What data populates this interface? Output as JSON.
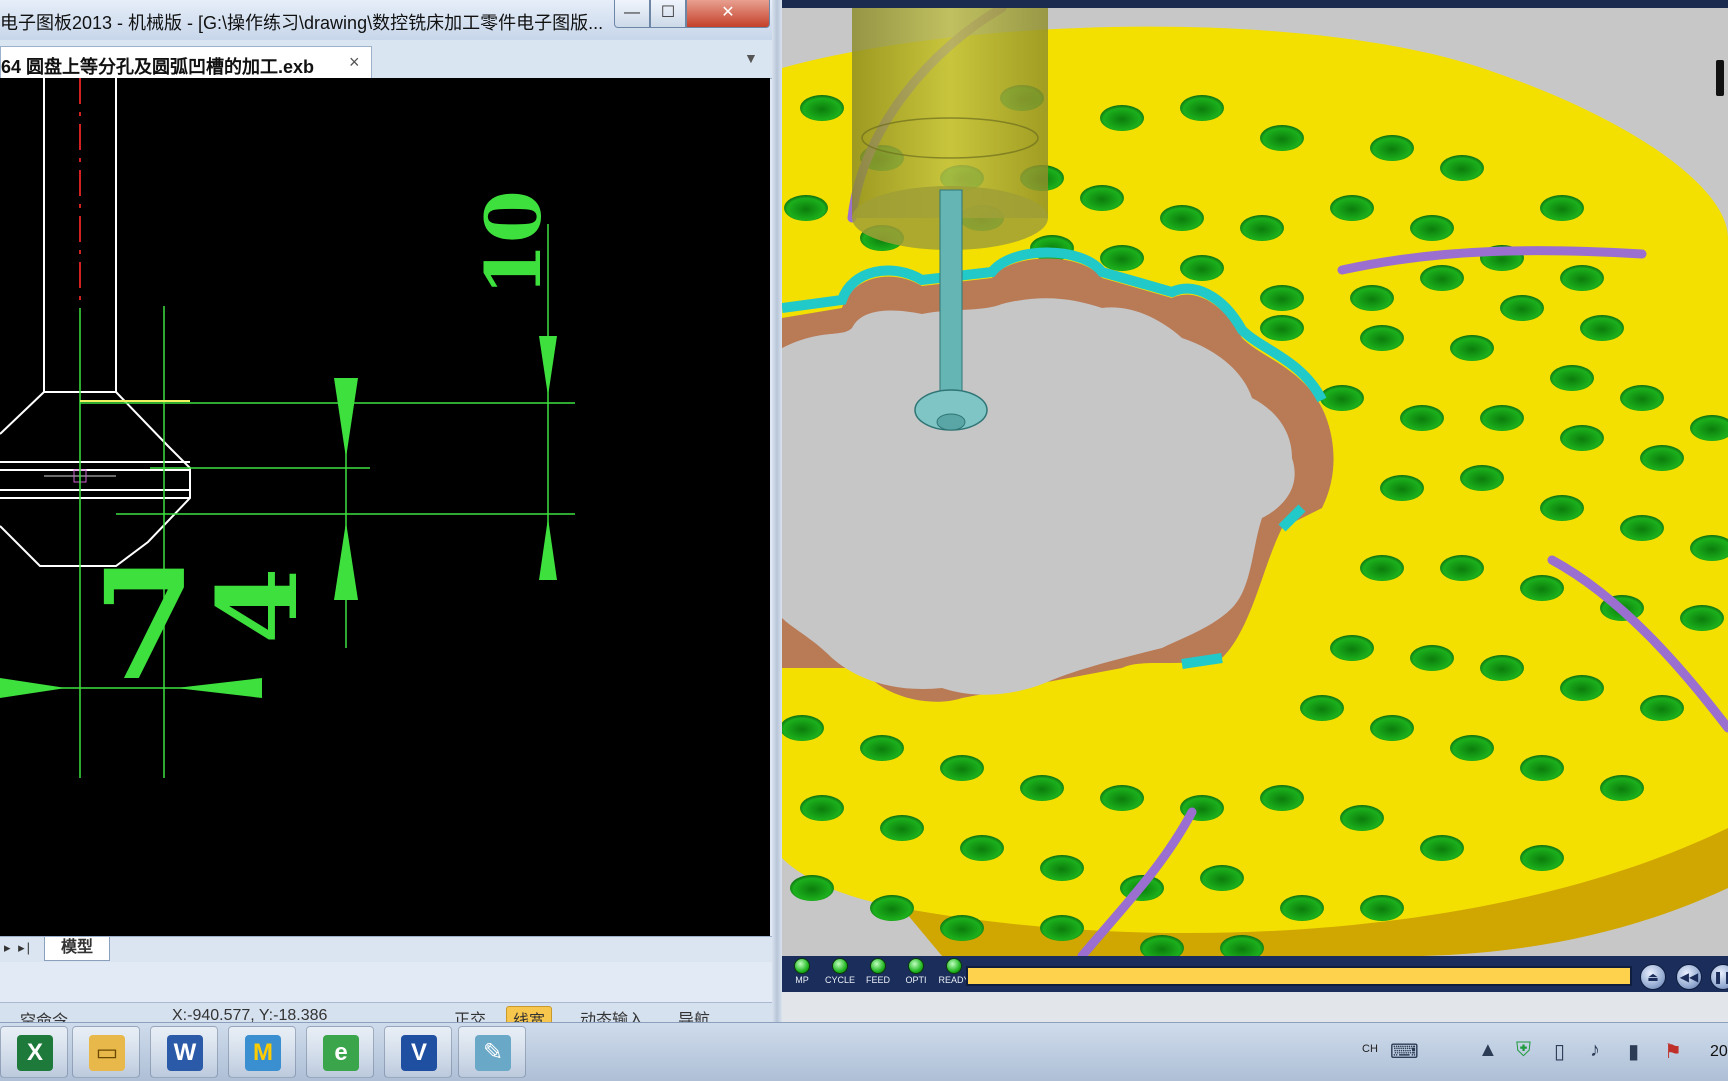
{
  "left_window": {
    "title": "电子图板2013 - 机械版 - [G:\\操作练习\\drawing\\数控铣床加工零件电子图版...",
    "controls": {
      "minimize": "—",
      "maximize": "☐",
      "close": "✕"
    },
    "tab": {
      "label": "64 圆盘上等分孔及圆弧凹槽的加工.exb",
      "close": "×",
      "dropdown": "▼"
    },
    "drawing": {
      "dimensions": [
        {
          "label": "10"
        },
        {
          "label": "7"
        },
        {
          "label": "4"
        }
      ]
    },
    "sheet_nav": "▸ ▸|",
    "sheet_tab": "模型",
    "status": {
      "command": "空命令",
      "coordinates": "X:-940.577, Y:-18.386",
      "ortho": "正交",
      "linewidth": "线宽",
      "dynamic_input": "动态输入",
      "navigation": "导航"
    }
  },
  "simulator": {
    "leds": [
      {
        "label": "MP"
      },
      {
        "label": "CYCLE"
      },
      {
        "label": "FEED"
      },
      {
        "label": "OPTI"
      },
      {
        "label": "READY"
      }
    ],
    "progress": 1.0,
    "buttons": {
      "eject": "⏏",
      "rewind": "◀◀",
      "pause": "❚❚"
    },
    "colors": {
      "stock": "#f3e000",
      "holes": "#1aa31a",
      "toolpath": "#9b6fd0",
      "pocket_wall": "#b97a56",
      "pocket_edge": "#22c9c9"
    }
  },
  "taskbar": {
    "apps": [
      {
        "icon": "X",
        "name": "excel-icon"
      },
      {
        "icon": "▭",
        "name": "file-explorer-icon"
      },
      {
        "icon": "W",
        "name": "word-icon"
      },
      {
        "icon": "M",
        "name": "mastercam-icon"
      },
      {
        "icon": "e",
        "name": "internet-explorer-icon"
      },
      {
        "icon": "V",
        "name": "vericut-icon"
      },
      {
        "icon": "✎",
        "name": "notepad-icon"
      }
    ],
    "tray": {
      "language": "CH",
      "clock": "20"
    }
  }
}
